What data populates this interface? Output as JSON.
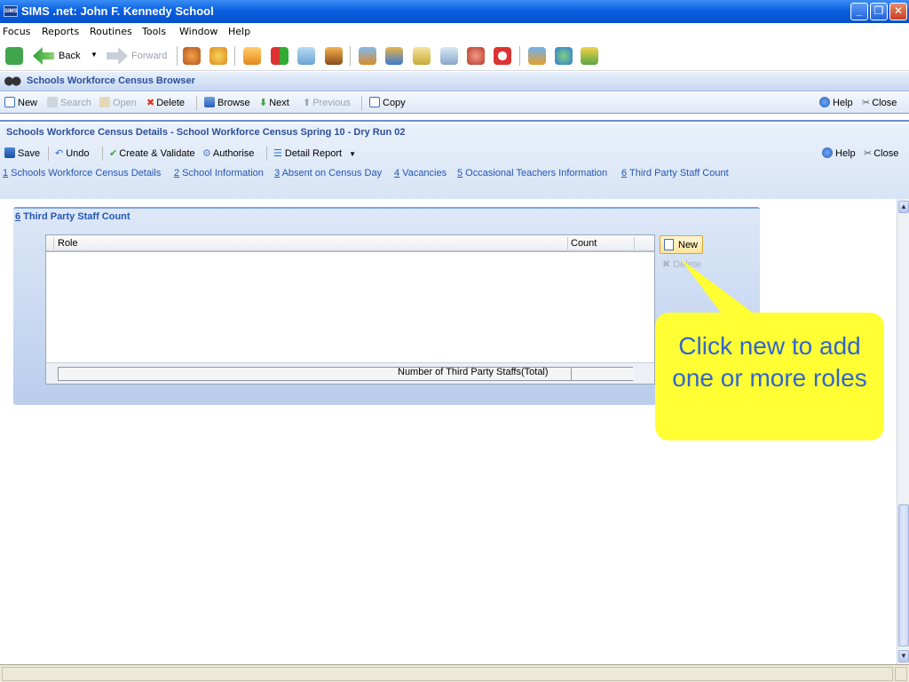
{
  "window": {
    "app_icon": "SIMS",
    "title": "SIMS .net: John F. Kennedy School"
  },
  "menu": {
    "focus": "Focus",
    "reports": "Reports",
    "routines": "Routines",
    "tools": "Tools",
    "window": "Window",
    "help": "Help"
  },
  "main_toolbar": {
    "back": "Back",
    "forward": "Forward"
  },
  "browser": {
    "title": "Schools Workforce Census Browser",
    "new": "New",
    "search": "Search",
    "open": "Open",
    "delete": "Delete",
    "browse": "Browse",
    "next": "Next",
    "previous": "Previous",
    "copy": "Copy",
    "help": "Help",
    "close": "Close"
  },
  "details": {
    "title": "Schools Workforce Census Details - School Workforce Census Spring 10 - Dry Run 02",
    "save": "Save",
    "undo": "Undo",
    "create_validate": "Create & Validate",
    "authorise": "Authorise",
    "detail_report": "Detail Report",
    "help": "Help",
    "close": "Close",
    "tabs": [
      {
        "num": "1",
        "label": " Schools Workforce Census Details"
      },
      {
        "num": "2",
        "label": " School Information"
      },
      {
        "num": "3",
        "label": " Absent on Census Day"
      },
      {
        "num": "4",
        "label": " Vacancies"
      },
      {
        "num": "5",
        "label": " Occasional Teachers Information"
      },
      {
        "num": "6",
        "label": " Third Party Staff Count"
      }
    ]
  },
  "section": {
    "num": "6",
    "title": " Third Party Staff Count",
    "columns": [
      "Role",
      "Count"
    ],
    "total_label": "Number of Third Party Staffs(Total)",
    "total_value": "",
    "new_button": "New",
    "delete_button": "Delete"
  },
  "callout": {
    "text": "Click new to add one or more roles",
    "fill": "#ffff33",
    "text_color": "#3366cc"
  }
}
